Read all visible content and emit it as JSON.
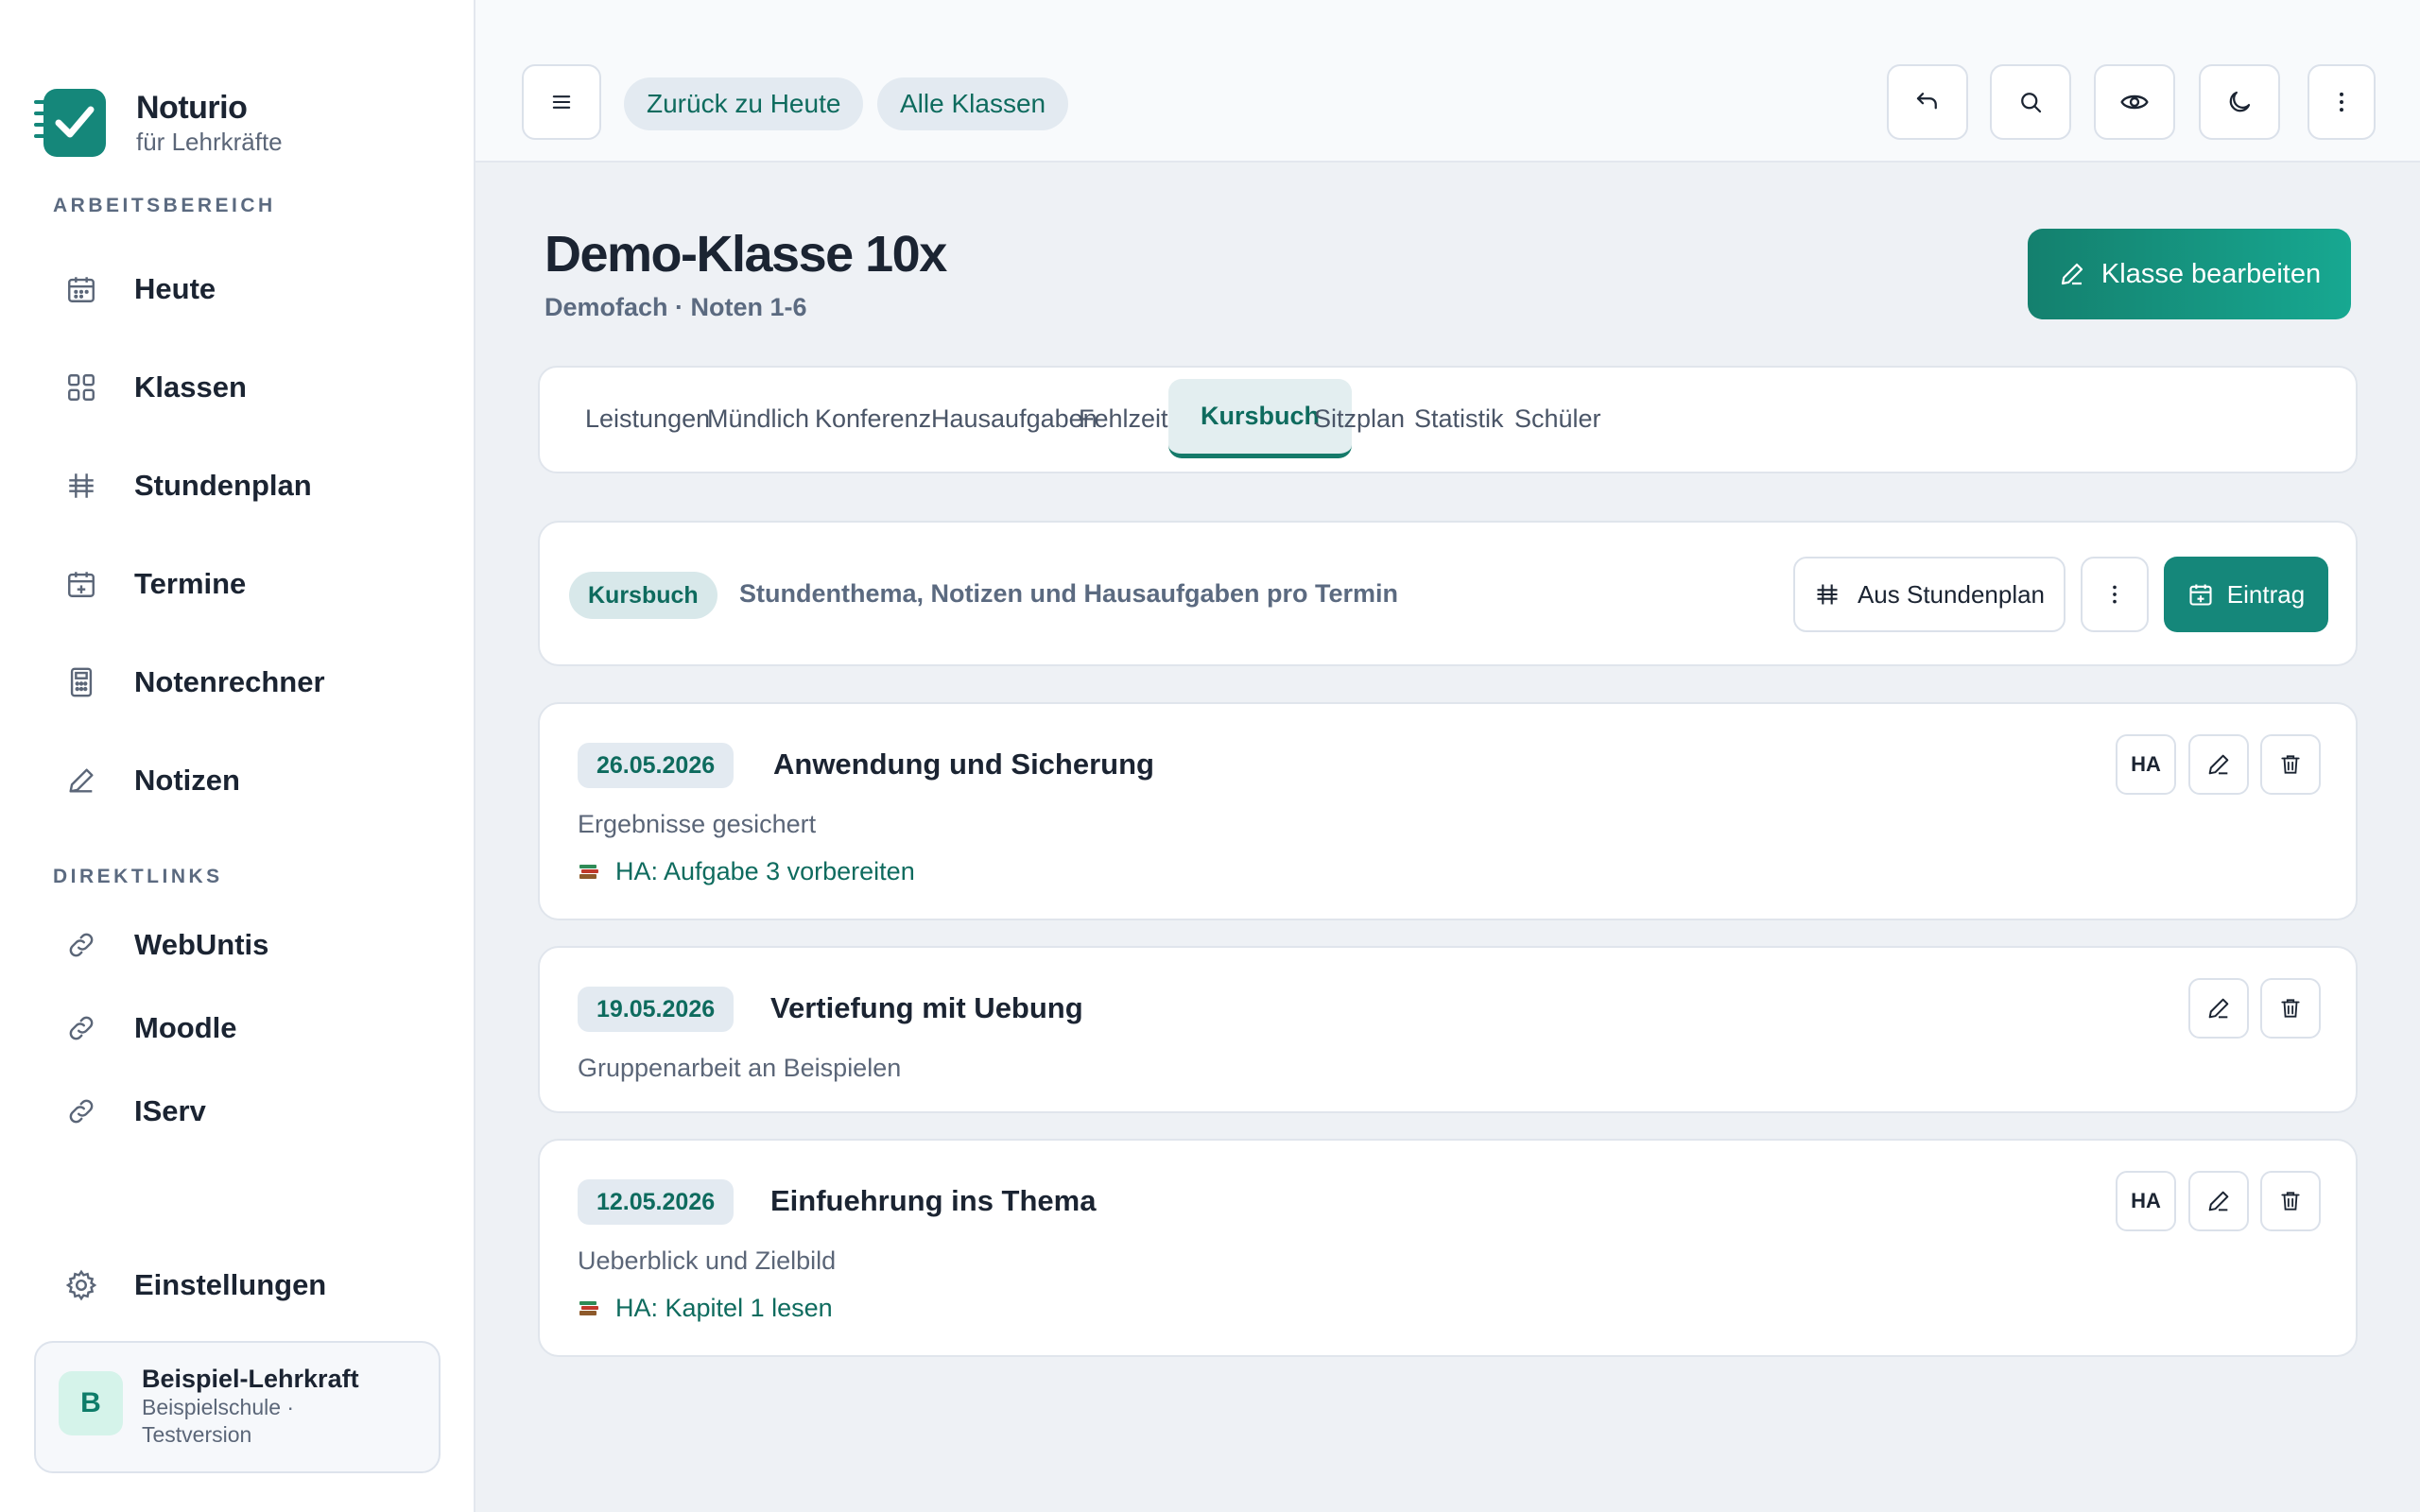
{
  "brand": {
    "name": "Noturio",
    "subtitle": "für Lehrkräfte"
  },
  "sidebar": {
    "workspace_label": "ARBEITSBEREICH",
    "items": [
      {
        "label": "Heute",
        "icon": "calendar-icon"
      },
      {
        "label": "Klassen",
        "icon": "grid-icon"
      },
      {
        "label": "Stundenplan",
        "icon": "timetable-icon"
      },
      {
        "label": "Termine",
        "icon": "calendar-plus-icon"
      },
      {
        "label": "Notenrechner",
        "icon": "calculator-icon"
      },
      {
        "label": "Notizen",
        "icon": "pencil-icon"
      }
    ],
    "links_label": "DIREKTLINKS",
    "links": [
      {
        "label": "WebUntis",
        "icon": "link-icon"
      },
      {
        "label": "Moodle",
        "icon": "link-icon"
      },
      {
        "label": "IServ",
        "icon": "link-icon"
      }
    ],
    "settings_label": "Einstellungen"
  },
  "user": {
    "initial": "B",
    "name": "Beispiel-Lehrkraft",
    "meta": "Beispielschule · Testversion"
  },
  "topbar": {
    "back_today": "Zurück zu Heute",
    "all_classes": "Alle Klassen"
  },
  "page": {
    "title": "Demo-Klasse 10x",
    "subtitle": "Demofach · Noten 1-6",
    "edit_button": "Klasse bearbeiten"
  },
  "tabs": [
    {
      "label": "Leistungen",
      "active": false
    },
    {
      "label": "Mündlich",
      "active": false
    },
    {
      "label": "Konferenz",
      "active": false
    },
    {
      "label": "Hausaufgaben",
      "active": false
    },
    {
      "label": "Fehlzeiten",
      "active": false
    },
    {
      "label": "Kursbuch",
      "active": true
    },
    {
      "label": "Sitzplan",
      "active": false
    },
    {
      "label": "Statistik",
      "active": false
    },
    {
      "label": "Schüler",
      "active": false
    }
  ],
  "kursbuch": {
    "badge": "Kursbuch",
    "description": "Stundenthema, Notizen und Hausaufgaben pro Termin",
    "from_timetable": "Aus Stundenplan",
    "add_entry": "Eintrag"
  },
  "entries": [
    {
      "date": "26.05.2026",
      "title": "Anwendung und Sicherung",
      "note": "Ergebnisse gesichert",
      "homework": "HA: Aufgabe 3 vorbereiten",
      "ha_badge": "HA"
    },
    {
      "date": "19.05.2026",
      "title": "Vertiefung mit Uebung",
      "note": "Gruppenarbeit an Beispielen",
      "homework": null,
      "ha_badge": null
    },
    {
      "date": "12.05.2026",
      "title": "Einfuehrung ins Thema",
      "note": "Ueberblick und Zielbild",
      "homework": "HA: Kapitel 1 lesen",
      "ha_badge": "HA"
    }
  ],
  "colors": {
    "accent": "#15877a",
    "accent_text": "#0e6b5e",
    "background": "#eef1f5"
  }
}
